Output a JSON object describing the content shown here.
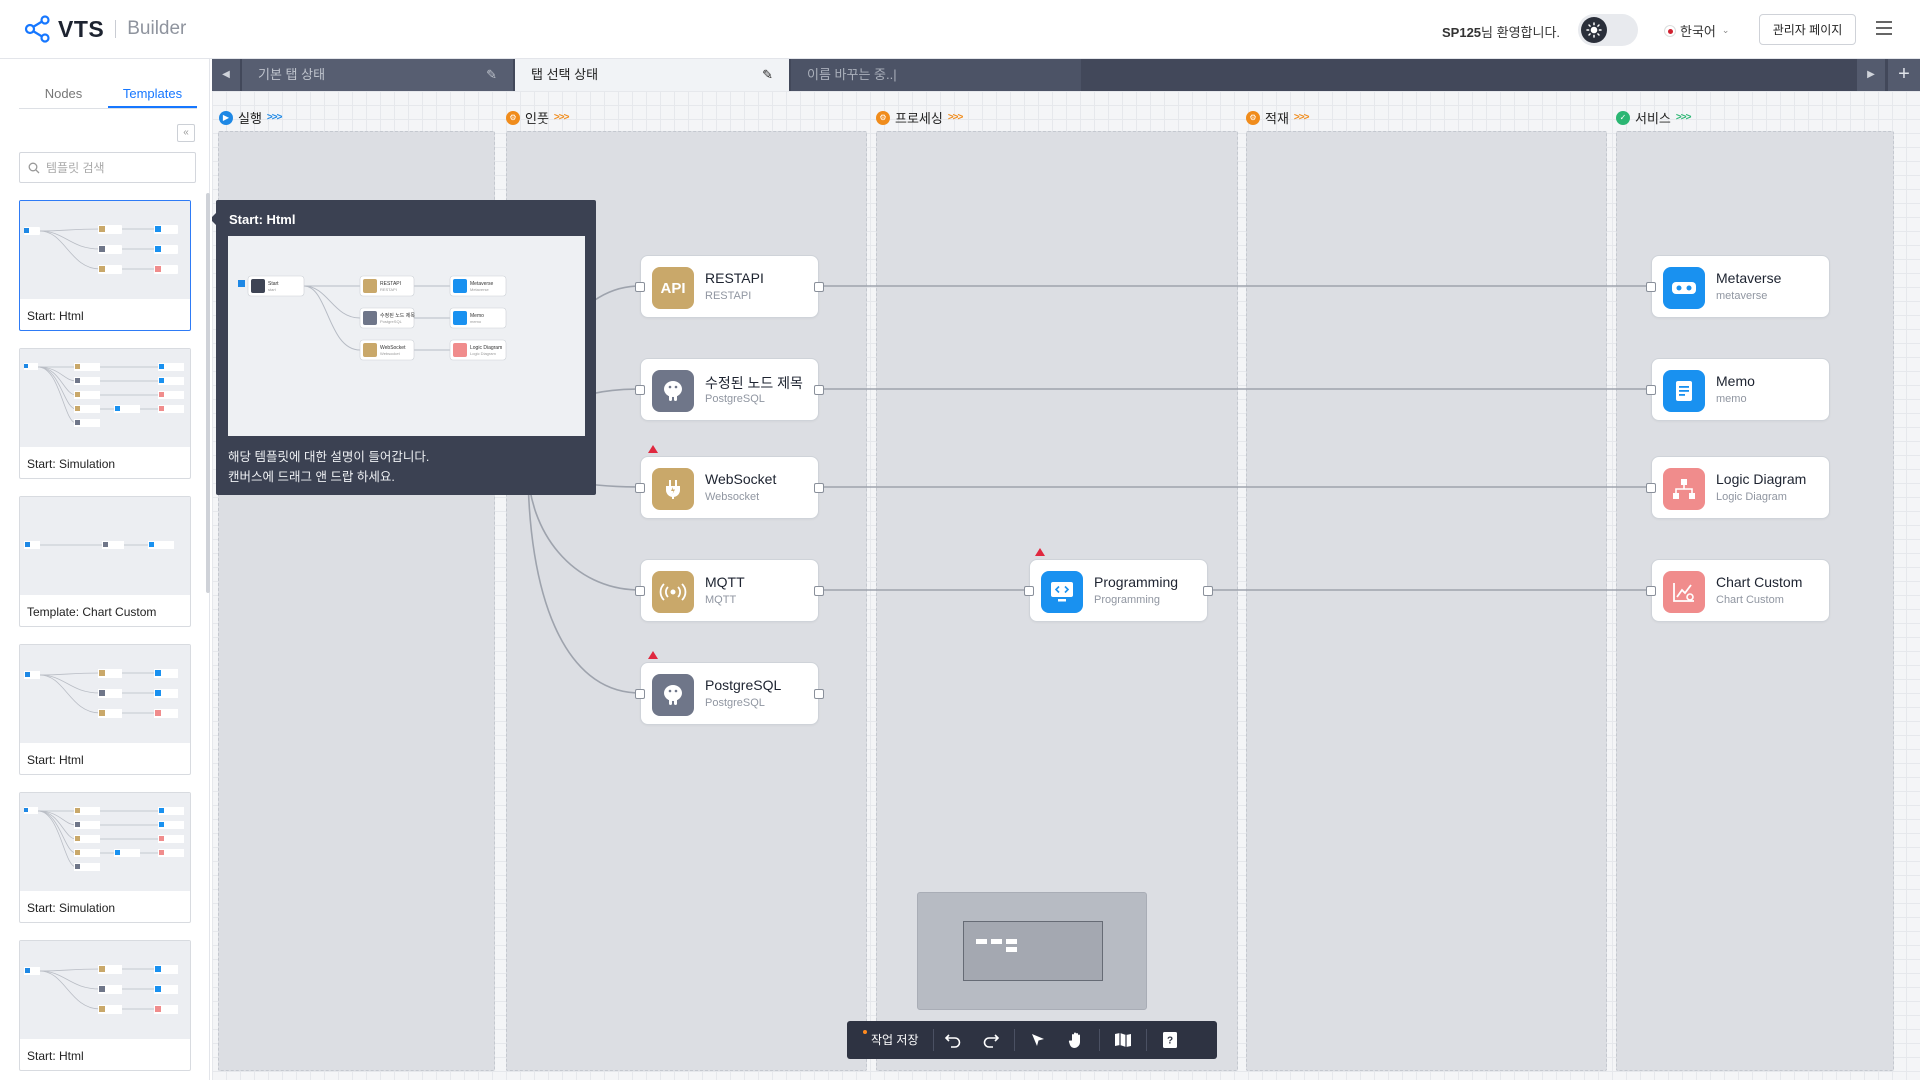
{
  "header": {
    "logo_text": "VTS",
    "logo_sub": "Builder",
    "welcome_user": "SP125",
    "welcome_suffix": "님 환영합니다.",
    "language": "한국어",
    "admin_label": "관리자 페이지"
  },
  "sidebar": {
    "tabs": [
      "Nodes",
      "Templates"
    ],
    "active_tab": "Templates",
    "search_placeholder": "템플릿 검색",
    "templates": [
      {
        "label": "Start: Html",
        "selected": true
      },
      {
        "label": "Start: Simulation"
      },
      {
        "label": "Template: Chart Custom"
      },
      {
        "label": "Start: Html"
      },
      {
        "label": "Start: Simulation"
      },
      {
        "label": "Start: Html"
      }
    ]
  },
  "tabs": [
    {
      "label": "기본 탭 상태",
      "state": "inactive"
    },
    {
      "label": "탭 선택 상태",
      "state": "active"
    },
    {
      "label": "이름 바꾸는 중..|",
      "state": "renaming"
    }
  ],
  "lanes": [
    {
      "label": "실행",
      "color": "#1e88e5"
    },
    {
      "label": "인풋",
      "color": "#f08c1c"
    },
    {
      "label": "프로세싱",
      "color": "#f08c1c"
    },
    {
      "label": "적재",
      "color": "#f08c1c"
    },
    {
      "label": "서비스",
      "color": "#2bb673"
    }
  ],
  "nodes": {
    "restapi": {
      "title": "RESTAPI",
      "sub": "RESTAPI",
      "icon_text": "API"
    },
    "pg_modified": {
      "title": "수정된 노드 제목",
      "sub": "PostgreSQL"
    },
    "websocket": {
      "title": "WebSocket",
      "sub": "Websocket"
    },
    "mqtt": {
      "title": "MQTT",
      "sub": "MQTT"
    },
    "postgresql": {
      "title": "PostgreSQL",
      "sub": "PostgreSQL"
    },
    "programming": {
      "title": "Programming",
      "sub": "Programming"
    },
    "metaverse": {
      "title": "Metaverse",
      "sub": "metaverse"
    },
    "memo": {
      "title": "Memo",
      "sub": "memo"
    },
    "logic": {
      "title": "Logic Diagram",
      "sub": "Logic Diagram"
    },
    "chart": {
      "title": "Chart Custom",
      "sub": "Chart Custom"
    }
  },
  "tooltip": {
    "title": "Start: Html",
    "desc_line1": "해당 템플릿에 대한 설명이 들어갑니다.",
    "desc_line2": "캔버스에 드래그 앤 드랍 하세요.",
    "preview": {
      "start_title": "Start",
      "start_sub": "start",
      "restapi_title": "RESTAPI",
      "restapi_sub": "RESTAPI",
      "pg_title": "수정된 노드 제목",
      "pg_sub": "PostgreSQL",
      "ws_title": "WebSocket",
      "ws_sub": "Websocket",
      "meta_title": "Metaverse",
      "meta_sub": "Metaverse",
      "memo_title": "Memo",
      "memo_sub": "memo",
      "logic_title": "Logic Diagram",
      "logic_sub": "Logic Diagram"
    }
  },
  "toolbar": {
    "save_label": "작업 저장"
  },
  "colors": {
    "gold": "#c9a86a",
    "slate": "#6f7689",
    "blue": "#1991f0",
    "salmon": "#f08c8c",
    "accent": "#1677ff"
  }
}
